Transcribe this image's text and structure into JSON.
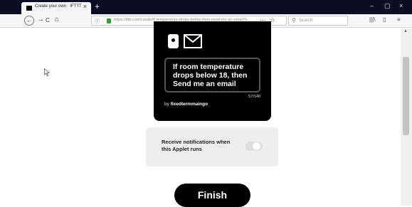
{
  "browser": {
    "tab_title": "Create your own · IFTTT",
    "new_tab": "+",
    "tab_close": "×",
    "window_controls": [
      "–",
      "▢",
      "×"
    ],
    "url": "https://ifttt.com/create/if-temperature-drops-below-then-send-me-an-email?s",
    "search_placeholder": "Search",
    "url_more": "···",
    "nav": {
      "back": "←",
      "forward": "→",
      "reload": "C",
      "home": "⌂"
    },
    "toolbar_icons": [
      "library-icon",
      "sidebar-icon",
      "menu-icon"
    ]
  },
  "applet": {
    "services": [
      "device-icon",
      "email-icon"
    ],
    "recipe_text": "If room temperature drops below 18, then Send me an email",
    "char_count": "57/140",
    "by_prefix": "by",
    "author": "fixedtermmaingo"
  },
  "notifications": {
    "label": "Receive notifications when this Applet runs",
    "enabled": false
  },
  "finish_label": "Finish",
  "colors": {
    "card_bg": "#000000",
    "tabbar_bg": "#0c0c23"
  }
}
